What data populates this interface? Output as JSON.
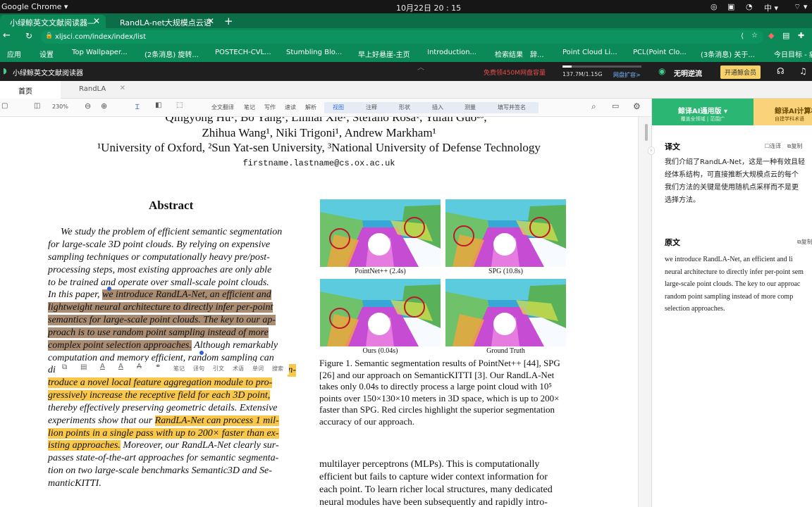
{
  "os": {
    "app": "Google Chrome ▾",
    "clock": "10月22日 20 : 15",
    "ime": "中 ▾"
  },
  "browser": {
    "tabs": [
      {
        "label": "小绿鲸英文文献阅读器—"
      },
      {
        "label": "RandLA-net大规模点云语"
      }
    ],
    "url": "xljsci.com/index/index/list",
    "bookmarks": [
      "应用",
      "设置",
      "Top Wallpaper...",
      "(2条消息) 旋转...",
      "POSTECH-CVL...",
      "Stumbling Blo...",
      "早上好悬崖-主页",
      "Introduction...",
      "检索结果",
      "辞...",
      "Point Cloud Li...",
      "PCL(Point Clo...",
      "(3条消息) 关于...",
      "今日目标 - 痛"
    ]
  },
  "app": {
    "title": "小绿鲸英文文献阅读器",
    "promo": "免费领450M网盘容量",
    "storage": "137.7M/1.15G",
    "expand": "网盘扩容>",
    "username": "无明逆流",
    "vip_button": "开通鲸会员"
  },
  "doctabs": [
    "首页",
    "RandLA"
  ],
  "toolbar": {
    "zoom": "230%",
    "items": [
      "全文翻译",
      "笔记",
      "写作",
      "速读",
      "解析",
      "视图",
      "注释",
      "形状",
      "插入",
      "测量",
      "填写并签名"
    ]
  },
  "paper": {
    "authors1": "Qingyong Hu¹, Bo Yang¹, Linhai Xie¹, Stefano Rosa¹, Yulan Guo²³,",
    "authors2": "Zhihua Wang¹, Niki Trigoni¹, Andrew Markham¹",
    "affil": "¹University of Oxford, ²Sun Yat-sen University, ³National University of Defense Technology",
    "email": "firstname.lastname@cs.ox.ac.uk",
    "abstract_title": "Abstract",
    "abs": [
      "We study the problem of efficient semantic segmentation",
      "for large-scale 3D point clouds.  By relying on expensive",
      "sampling techniques or computationally heavy pre/post-",
      "processing steps, most existing approaches are only able",
      "to be trained and operate over small-scale point clouds.",
      "In this paper, ",
      "we introduce RandLA-Net, an efficient and",
      "lightweight neural architecture to directly infer per-point",
      "semantics for large-scale point clouds. The key to our ap-",
      "proach is to use random point sampling instead of more",
      "complex point selection approaches.",
      " Although remarkably",
      "computation and memory efficient, random sampling can",
      "di",
      "n-",
      "troduce a novel local feature aggregation module to pro-",
      "gressively increase the receptive field for each 3D point,",
      "thereby effectively preserving geometric details. Extensive",
      "experiments show that our ",
      "RandLA-Net can process 1 mil-",
      "lion points in a single pass with up to 200× faster than ex-",
      "isting approaches.",
      " Moreover, our RandLA-Net clearly sur-",
      "passes state-of-the-art approaches for semantic segmenta-",
      "tion on two large-scale benchmarks Semantic3D and Se-",
      "manticKITTI."
    ],
    "popup": [
      "笔记",
      "译句",
      "引文",
      "术语",
      "单词",
      "搜索"
    ],
    "fig_labels": [
      "PointNet++ (2.4s)",
      "SPG (10.8s)",
      "Ours (0.04s)",
      "Ground Truth"
    ],
    "caption": [
      "Figure 1. Semantic segmentation results of PointNet++ [44], SPG",
      "[26] and our approach on SemanticKITTI [3].  Our RandLA-Net",
      "takes only 0.04s to directly process a large point cloud with 10⁵",
      "points over 150×130×10 meters in 3D space, which is up to 200×",
      "faster than SPG. Red circles highlight the superior segmentation",
      "accuracy of our approach."
    ],
    "body": [
      "multilayer perceptrons (MLPs).  This is computationally",
      "efficient but fails to capture wider context information for",
      "each point. To learn richer local structures, many dedicated",
      "neural modules have been subsequently and rapidly intro-"
    ]
  },
  "sidebar": {
    "tab1": "鲸译AI通用版 ▾",
    "tab1_sub": "覆盖全领域 | 范围广",
    "tab2": "鲸译AI计算机",
    "tab2_sub": "自建学科术语",
    "trans_title": "译文",
    "opt1": "连译",
    "opt2": "复制",
    "trans": [
      "我们介绍了RandLA-Net，这是一种有效且轻",
      "经体系结构，可直接推断大规模点云的每个",
      "我们方法的关键是使用随机点采样而不是更",
      "选择方法。"
    ],
    "orig_title": "原文",
    "orig_copy": "复制",
    "orig": [
      "we introduce RandLA-Net, an efficient and li",
      "neural architecture to directly infer per-point sem",
      "large-scale point clouds. The key to our approac",
      "random point sampling instead of more comp",
      "selection approaches."
    ]
  }
}
